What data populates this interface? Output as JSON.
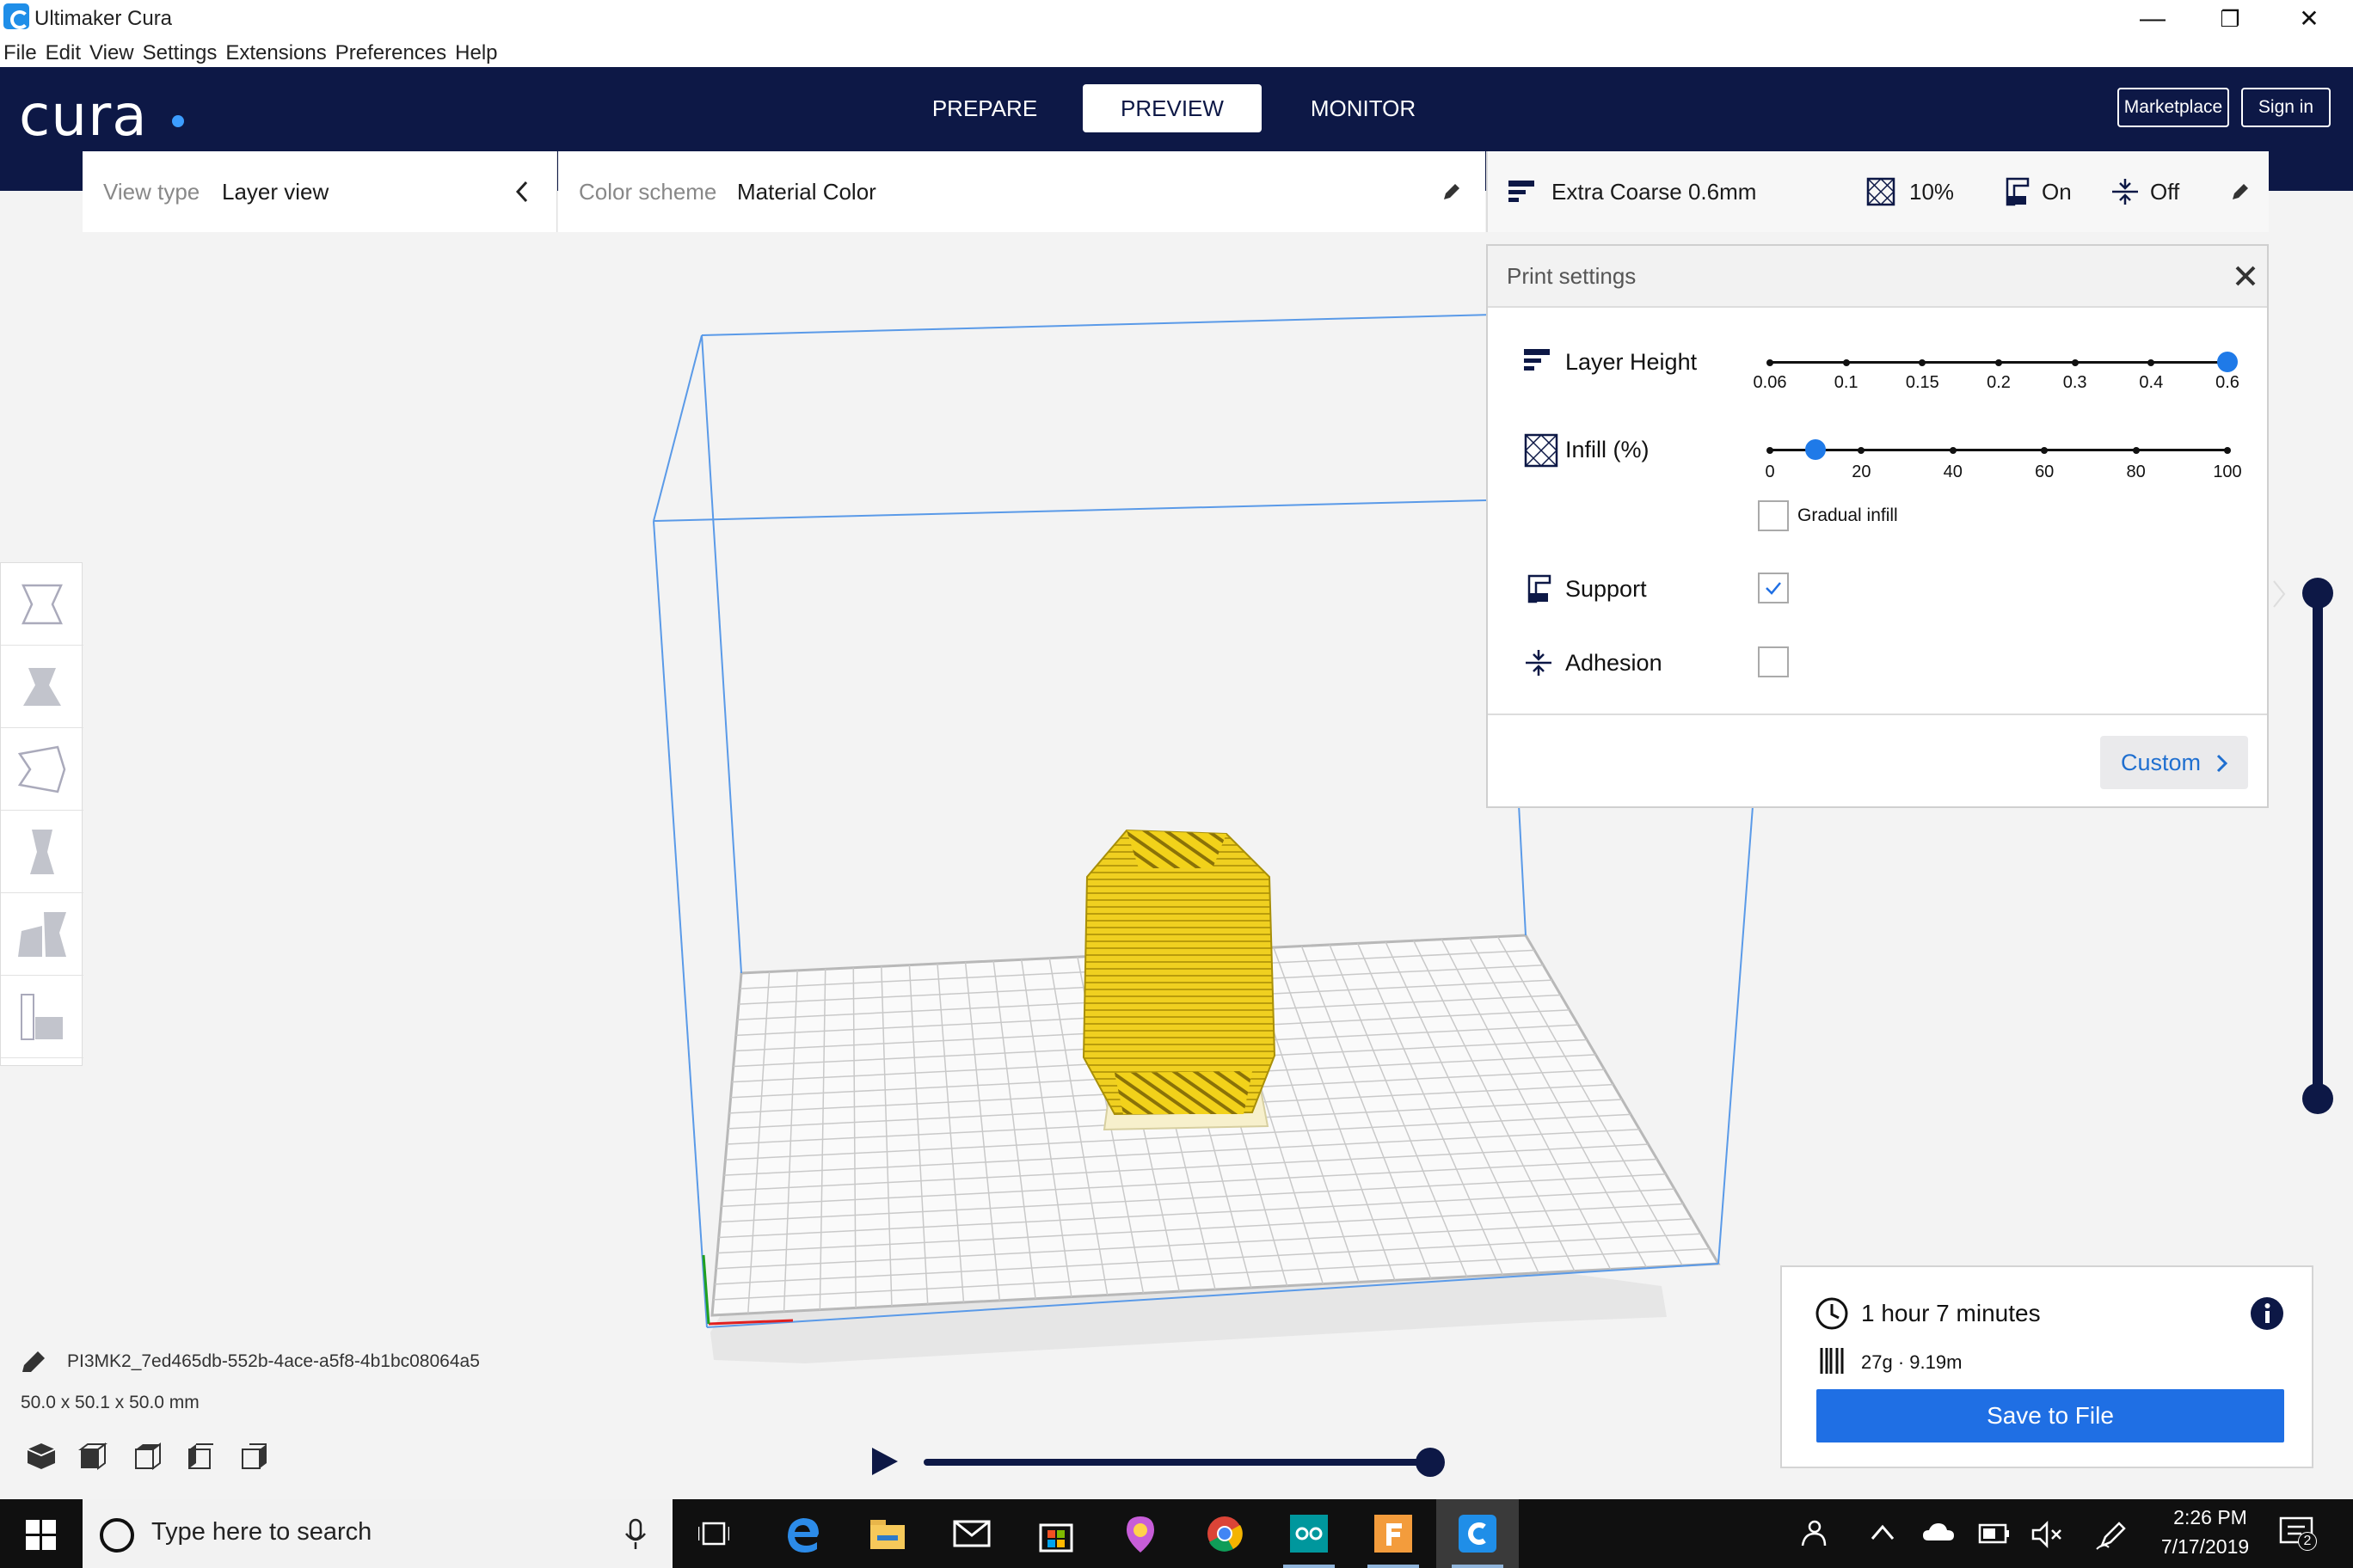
{
  "window": {
    "title": "Ultimaker Cura",
    "minimize": "—",
    "restore": "❐",
    "close": "✕"
  },
  "menu": [
    "File",
    "Edit",
    "View",
    "Settings",
    "Extensions",
    "Preferences",
    "Help"
  ],
  "header": {
    "logo": "cura",
    "tabs": {
      "prepare": "PREPARE",
      "preview": "PREVIEW",
      "monitor": "MONITOR"
    },
    "active_tab": "PREVIEW",
    "marketplace": "Marketplace",
    "sign_in": "Sign in"
  },
  "view_panel": {
    "label": "View type",
    "value": "Layer view",
    "toggle_icon": "chevron-left-icon"
  },
  "color_panel": {
    "label": "Color scheme",
    "value": "Material Color",
    "edit_icon": "pencil-icon"
  },
  "settings_bar": {
    "profile": "Extra Coarse 0.6mm",
    "infill": "10%",
    "support": "On",
    "adhesion": "Off",
    "edit_icon": "pencil-icon"
  },
  "print_settings": {
    "title": "Print settings",
    "close_icon": "close-icon",
    "layer_height": {
      "label": "Layer Height",
      "ticks": [
        "0.06",
        "0.1",
        "0.15",
        "0.2",
        "0.3",
        "0.4",
        "0.6"
      ],
      "selected_index": 6
    },
    "infill": {
      "label": "Infill (%)",
      "ticks": [
        "0",
        "20",
        "40",
        "60",
        "80",
        "100"
      ],
      "value_percent": 10
    },
    "gradual_infill": {
      "label": "Gradual infill",
      "checked": false
    },
    "support": {
      "label": "Support",
      "checked": true
    },
    "adhesion": {
      "label": "Adhesion",
      "checked": false
    },
    "custom_button": "Custom"
  },
  "left_tools": [
    "move-tool-icon",
    "scale-tool-icon",
    "rotate-tool-icon",
    "mirror-tool-icon",
    "per-model-settings-icon",
    "support-blocker-icon"
  ],
  "object": {
    "name": "PI3MK2_7ed465db-552b-4ace-a5f8-4b1bc08064a5",
    "dimensions": "50.0 x 50.1 x 50.0 mm"
  },
  "view_cubes": [
    "3d-view-icon",
    "front-view-icon",
    "top-view-icon",
    "left-view-icon",
    "right-view-icon"
  ],
  "print_info": {
    "time": "1 hour 7 minutes",
    "material": "27g · 9.19m",
    "save_button": "Save to File"
  },
  "colors": {
    "header": "#0d1846",
    "accent": "#1f6fe4",
    "model": "#f0d020"
  },
  "taskbar": {
    "search_placeholder": "Type here to search",
    "time": "2:26 PM",
    "date": "7/17/2019",
    "notification_count": "2"
  }
}
